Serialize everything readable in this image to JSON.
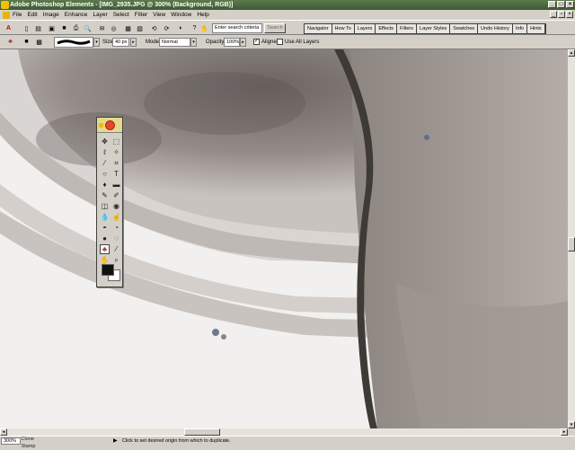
{
  "window": {
    "title": "Adobe Photoshop Elements - [IMG_2935.JPG @ 300% (Background, RGB)]"
  },
  "menus": [
    "File",
    "Edit",
    "Image",
    "Enhance",
    "Layer",
    "Select",
    "Filter",
    "View",
    "Window",
    "Help"
  ],
  "shortcuts": {
    "search_placeholder": "Enter search criteria",
    "search_button": "Search",
    "palette_tabs": [
      "Navigator",
      "How To",
      "Layers",
      "Effects",
      "Filters",
      "Layer Styles",
      "Swatches",
      "Undo History",
      "Info",
      "Hints"
    ]
  },
  "options": {
    "size_label": "Size:",
    "size_value": "40 px",
    "mode_label": "Mode:",
    "mode_value": "Normal",
    "opacity_label": "Opacity:",
    "opacity_value": "100%",
    "aligned_label": "Aligned",
    "aligned_checked": true,
    "use_all_layers_label": "Use All Layers",
    "use_all_layers_checked": false
  },
  "status": {
    "zoom": "300%",
    "tool": "Clone Stamp",
    "hint": "Click to set desired origin from which to duplicate."
  },
  "colors": {
    "foreground": "#111111",
    "background": "#ffffff",
    "titlebar": "#4a6a3e"
  }
}
